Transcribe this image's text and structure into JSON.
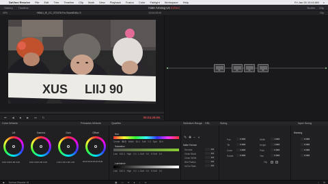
{
  "menubar": {
    "app": "DaVinci Resolve",
    "items": [
      "File",
      "Edit",
      "Trim",
      "Timeline",
      "Clip",
      "Mark",
      "View",
      "Playback",
      "Fusion",
      "Color",
      "Fairlight",
      "Workspace",
      "Help"
    ],
    "right": [
      "Fri Jan 26 10:44 AM"
    ]
  },
  "toolbar": {
    "left": [
      "Gallery",
      "Timeline"
    ],
    "project": "Hate Among Us",
    "edited": "Edited",
    "right": [
      "Nodes",
      "Clip"
    ]
  },
  "viewer": {
    "left_label": "Hate Among Us",
    "clip_name": "HBAU_IE_CC_ST2478 For BoomEdit p 3",
    "zoom": "45%",
    "timecode_hdr": "00:04:25:05",
    "timecode": "00:04:25:05"
  },
  "sign_text": "  XUS     LIIJ  90",
  "nodes": {
    "header": "Clip",
    "items": [
      "01",
      "02",
      "03",
      "04"
    ]
  },
  "tabs": {
    "color_wheels": "Color Wheels",
    "primaries": "Primaries Wheels",
    "qualifier": "Qualifier",
    "selection_range": "Selection Range",
    "hsl": "HSL",
    "sizing": "Sizing",
    "input_sizing": "Input Sizing",
    "blanking": "Blanking"
  },
  "wheels": [
    {
      "name": "Lift",
      "values": [
        "0.00",
        "0.00",
        "0.00",
        "0.00"
      ]
    },
    {
      "name": "Gamma",
      "values": [
        "0.00",
        "0.00",
        "0.00",
        "0.00"
      ]
    },
    {
      "name": "Gain",
      "values": [
        "1.00",
        "1.00",
        "1.00",
        "1.00"
      ]
    },
    {
      "name": "Offset",
      "values": [
        "25.00",
        "25.00",
        "25.00",
        "25.00"
      ]
    }
  ],
  "qualifier": {
    "hue_label": "Hue",
    "hue_vals": [
      "Center",
      "50.0",
      "Width",
      "30.4",
      "Soft",
      "0.0",
      "Sym",
      "50.0"
    ],
    "sat_label": "Saturation",
    "sat_vals": [
      "Low",
      "100.0",
      "High",
      "0.0",
      "L.Soft",
      "0.0",
      "H.Soft",
      "0.0"
    ],
    "lum_label": "Luminance",
    "lum_vals": [
      "Low",
      "100.0",
      "High",
      "0.0",
      "L.Soft",
      "0.0",
      "H.Soft",
      "0.0"
    ]
  },
  "matte": {
    "label": "Matte Finesse",
    "rows": [
      {
        "k": "Denoise",
        "v": "0.0"
      },
      {
        "k": "Clean Black",
        "v": "0.0"
      },
      {
        "k": "Clean White",
        "v": "0.0"
      },
      {
        "k": "Blur Radius",
        "v": "0.0"
      },
      {
        "k": "In/Out Ratio",
        "v": "0.0"
      }
    ]
  },
  "sizing": {
    "rows": [
      {
        "k1": "Pan",
        "v1": "0.000",
        "k2": "Width",
        "v2": "1.000"
      },
      {
        "k1": "Tilt",
        "v1": "0.000",
        "k2": "Height",
        "v2": "1.000"
      },
      {
        "k1": "Zoom",
        "v1": "1.000",
        "k2": "Pitch",
        "v2": "0.000"
      },
      {
        "k1": "Rotate",
        "v1": "0.000",
        "k2": "Yaw",
        "v2": "0.000"
      }
    ],
    "flip": "Flip"
  },
  "blanking": {
    "rows": [
      "0.000",
      "0.000",
      "0.000",
      "0.000"
    ]
  },
  "status": {
    "app": "DaVinci Resolve 15"
  }
}
